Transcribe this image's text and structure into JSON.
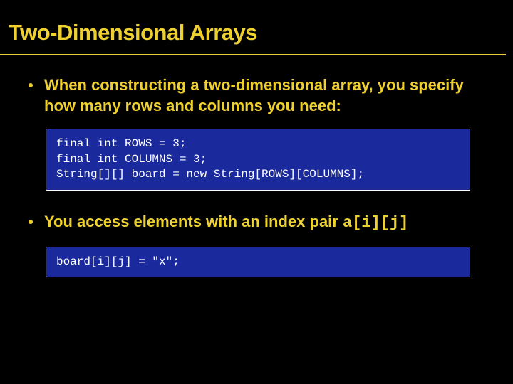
{
  "title": "Two-Dimensional Arrays",
  "bullets": [
    {
      "text": "When constructing a two-dimensional array, you specify how many rows and columns you need:"
    },
    {
      "text_before": "You access elements with an index pair ",
      "code": "a[i][j]"
    }
  ],
  "code1": "final int ROWS = 3;\nfinal int COLUMNS = 3;\nString[][] board = new String[ROWS][COLUMNS];",
  "code2": "board[i][j] = \"x\";"
}
